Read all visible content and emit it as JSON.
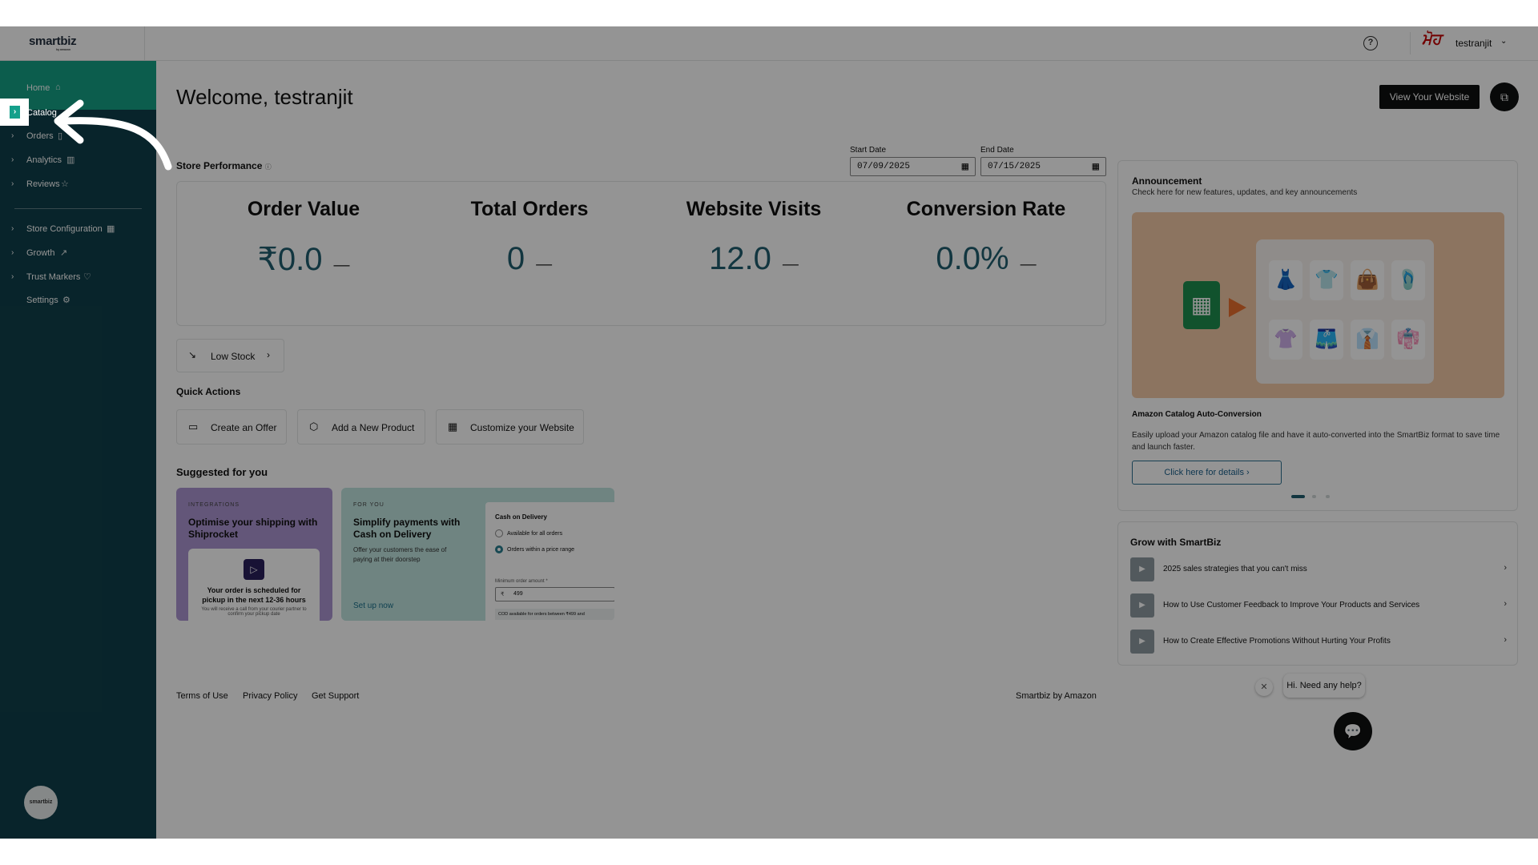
{
  "header": {
    "logo_text": "smartbiz",
    "logo_sub": "by amazon",
    "help_symbol": "?",
    "user_signature": "ਮੋਹ",
    "username": "testranjit",
    "user_menu_chevron": "⌄"
  },
  "sidebar": {
    "items": [
      {
        "label": "Home",
        "icon": "home-icon"
      },
      {
        "label": "Catalog",
        "icon": "catalog-icon"
      },
      {
        "label": "Orders",
        "icon": "orders-icon"
      },
      {
        "label": "Analytics",
        "icon": "analytics-icon"
      },
      {
        "label": "Reviews",
        "icon": "star-icon"
      },
      {
        "label": "Store Configuration",
        "icon": "store-icon"
      },
      {
        "label": "Growth",
        "icon": "growth-icon"
      },
      {
        "label": "Trust Markers",
        "icon": "shield-icon"
      },
      {
        "label": "Settings",
        "icon": "gear-icon"
      }
    ],
    "avatar_text": "smartbiz"
  },
  "main": {
    "welcome": "Welcome, testranjit",
    "view_website": "View Your Website",
    "store_performance": "Store Performance",
    "start_date_label": "Start Date",
    "start_date": "07/09/2025",
    "end_date_label": "End Date",
    "end_date": "07/15/2025",
    "metrics": [
      {
        "title": "Order Value",
        "value": "₹0.0",
        "trend": "—"
      },
      {
        "title": "Total Orders",
        "value": "0",
        "trend": "—"
      },
      {
        "title": "Website Visits",
        "value": "12.0",
        "trend": "—"
      },
      {
        "title": "Conversion Rate",
        "value": "0.0%",
        "trend": "—"
      }
    ],
    "low_stock": "Low Stock",
    "quick_actions_title": "Quick Actions",
    "quick_actions": [
      {
        "label": "Create an Offer",
        "icon": "offer-icon"
      },
      {
        "label": "Add a New Product",
        "icon": "box-icon"
      },
      {
        "label": "Customize your Website",
        "icon": "storefront-icon"
      }
    ],
    "suggested_title": "Suggested for you",
    "suggested": [
      {
        "tag": "INTEGRATIONS",
        "title": "Optimise your shipping with Shiprocket",
        "card_text": "Your order is scheduled for pickup in the next 12-36 hours",
        "card_sub": "You will receive a call from your courier partner to confirm your pickup date"
      },
      {
        "tag": "FOR YOU",
        "title": "Simplify payments with Cash on Delivery",
        "desc": "Offer your customers the ease of paying at their doorstep",
        "link": "Set up now",
        "panel_title": "Cash on Delivery",
        "option1": "Available for all orders",
        "option2": "Orders within a price range",
        "min_label": "Minimum order amount *",
        "currency": "₹",
        "min_value": "499",
        "note": "COD available for orders between ₹499 and"
      }
    ]
  },
  "footer": {
    "terms": "Terms of Use",
    "privacy": "Privacy Policy",
    "support": "Get Support",
    "brand": "Smartbiz by Amazon"
  },
  "announcement": {
    "title": "Announcement",
    "subtitle": "Check here for new features, updates, and key announcements",
    "item_title": "Amazon Catalog Auto-Conversion",
    "item_desc": "Easily upload your Amazon catalog file and have it auto-converted into the SmartBiz format to save time and launch faster.",
    "button": "Click here for details ›"
  },
  "grow": {
    "title": "Grow with SmartBiz",
    "items": [
      "2025 sales strategies that you can't miss",
      "How to Use Customer Feedback to Improve Your Products and Services",
      "How to Create Effective Promotions Without Hurting Your Profits"
    ]
  },
  "help_widget": {
    "text": "Hi. Need any help?",
    "close_symbol": "✕"
  }
}
